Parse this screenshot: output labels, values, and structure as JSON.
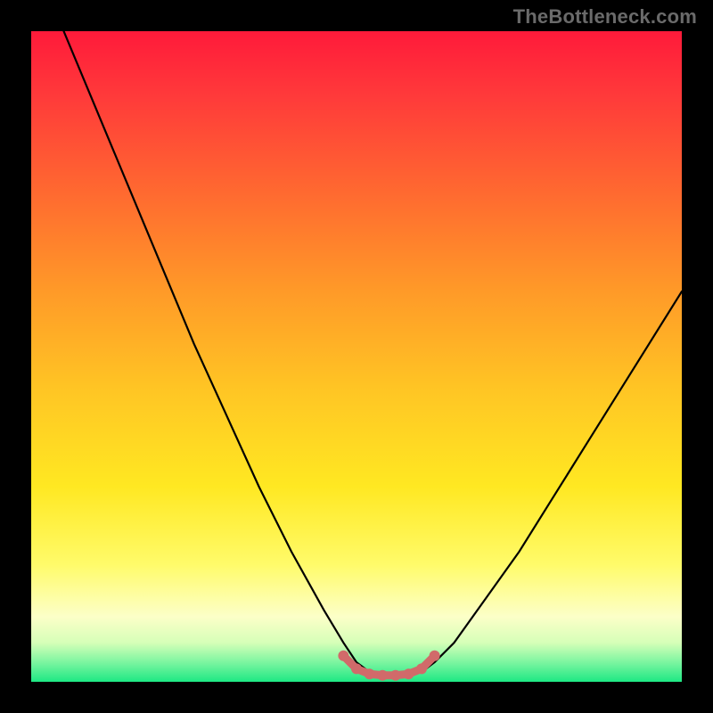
{
  "watermark": "TheBottleneck.com",
  "chart_data": {
    "type": "line",
    "title": "",
    "xlabel": "",
    "ylabel": "",
    "xlim": [
      0,
      100
    ],
    "ylim": [
      0,
      100
    ],
    "series": [
      {
        "name": "bottleneck-curve",
        "x": [
          5,
          10,
          15,
          20,
          25,
          30,
          35,
          40,
          45,
          48,
          50,
          52,
          54,
          56,
          58,
          60,
          62,
          65,
          70,
          75,
          80,
          85,
          90,
          95,
          100
        ],
        "y": [
          100,
          88,
          76,
          64,
          52,
          41,
          30,
          20,
          11,
          6,
          3,
          1.5,
          1,
          1,
          1,
          1.5,
          3,
          6,
          13,
          20,
          28,
          36,
          44,
          52,
          60
        ]
      }
    ],
    "markers": {
      "name": "bottom-points",
      "color": "#d16a6a",
      "x": [
        48,
        50,
        52,
        54,
        56,
        58,
        60,
        62
      ],
      "y": [
        4,
        2,
        1.2,
        1,
        1,
        1.2,
        2,
        4
      ]
    },
    "gradient_stops": [
      {
        "pos": 0,
        "color": "#ff1a3a"
      },
      {
        "pos": 25,
        "color": "#ff6a30"
      },
      {
        "pos": 55,
        "color": "#ffc524"
      },
      {
        "pos": 82,
        "color": "#fffb6a"
      },
      {
        "pos": 100,
        "color": "#1ee884"
      }
    ]
  }
}
